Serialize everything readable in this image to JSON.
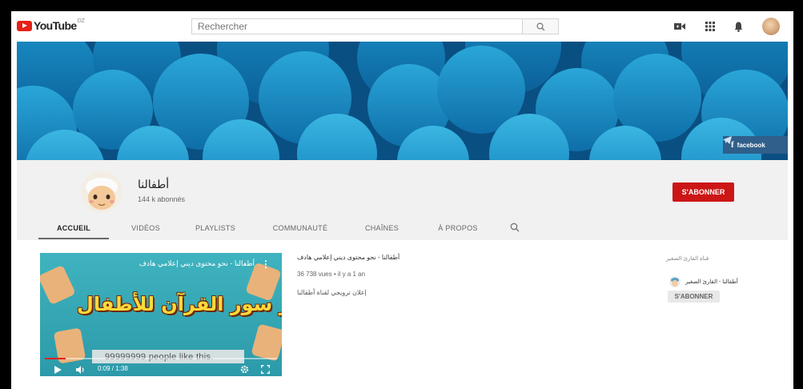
{
  "masthead": {
    "logo_text": "YouTube",
    "region": "DZ",
    "search_placeholder": "Rechercher",
    "icons": [
      "upload-video-icon",
      "apps-grid-icon",
      "notifications-bell-icon"
    ]
  },
  "banner": {
    "social_label": "facebook",
    "social_icons": [
      "facebook-icon",
      "telegram-icon"
    ]
  },
  "channel": {
    "name": "أطفالنا",
    "subscribers": "144 k abonnés",
    "subscribe_label": "S'ABONNER"
  },
  "tabs": [
    {
      "label": "ACCUEIL",
      "active": true
    },
    {
      "label": "VIDÉOS",
      "active": false
    },
    {
      "label": "PLAYLISTS",
      "active": false
    },
    {
      "label": "COMMUNAUTÉ",
      "active": false
    },
    {
      "label": "CHAÎNES",
      "active": false
    },
    {
      "label": "À PROPOS",
      "active": false
    }
  ],
  "featured": {
    "player_title": "أطفالنا - نحو محتوى ديني إعلامي هادف",
    "art_text": "تفسير سور القرآن للأطفال",
    "caption": "99999999 people like this.",
    "time": "0:09 / 1:38",
    "progress_fraction": 0.09,
    "title": "أطفالنا - نحو محتوى ديني إعلامي هادف",
    "meta": "36 738 vues • il y a 1 an",
    "description": "إعلان ترويجي لقناة أطفالنا"
  },
  "sidebar": {
    "header": "قناة القارئ الصغير",
    "channel_name": "أطفالنا - القارئ الصغير",
    "subscribe_label": "S'ABONNER"
  },
  "colors": {
    "brand_red": "#e62117",
    "subscribe_red": "#cc1616",
    "banner_blue": "#0c6ea8"
  }
}
